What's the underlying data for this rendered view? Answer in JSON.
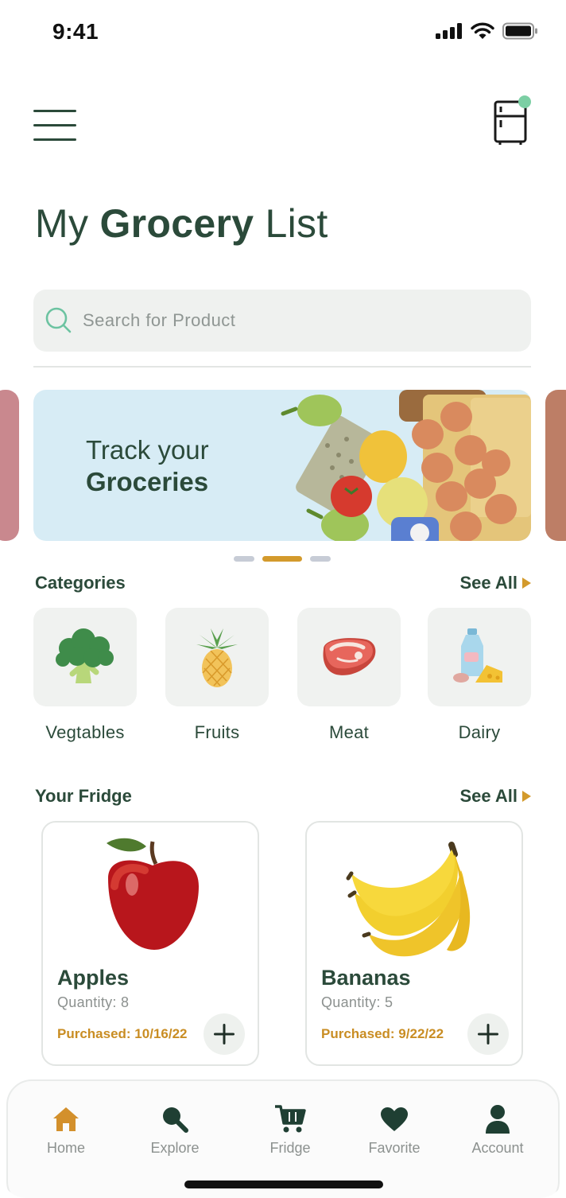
{
  "status_bar": {
    "time": "9:41"
  },
  "header": {
    "title_prefix": "My ",
    "title_bold": "Grocery",
    "title_suffix": " List"
  },
  "search": {
    "placeholder": "Search for Product"
  },
  "banner": {
    "line1": "Track your",
    "line2": "Groceries",
    "active_slide": 2,
    "slide_count": 3
  },
  "categories": {
    "title": "Categories",
    "see_all": "See All",
    "items": [
      {
        "label": "Vegtables",
        "icon": "broccoli-icon"
      },
      {
        "label": "Fruits",
        "icon": "pineapple-icon"
      },
      {
        "label": "Meat",
        "icon": "steak-icon"
      },
      {
        "label": "Dairy",
        "icon": "milk-cheese-icon"
      }
    ]
  },
  "fridge": {
    "title": "Your Fridge",
    "see_all": "See All",
    "items": [
      {
        "name": "Apples",
        "quantity": "Quantity: 8",
        "purchased": "Purchased: 10/16/22"
      },
      {
        "name": "Bananas",
        "quantity": "Quantity: 5",
        "purchased": "Purchased: 9/22/22"
      }
    ]
  },
  "bottom_nav": {
    "items": [
      {
        "label": "Home",
        "icon": "home-icon",
        "active": true
      },
      {
        "label": "Explore",
        "icon": "search-icon"
      },
      {
        "label": "Fridge",
        "icon": "cart-icon"
      },
      {
        "label": "Favorite",
        "icon": "heart-icon"
      },
      {
        "label": "Account",
        "icon": "user-icon"
      }
    ]
  },
  "colors": {
    "primary": "#2b4a3a",
    "accent": "#d39a2c",
    "tile_bg": "#f0f2f0",
    "banner_bg": "#d7ecf5",
    "notification_dot": "#7ccfa4"
  }
}
